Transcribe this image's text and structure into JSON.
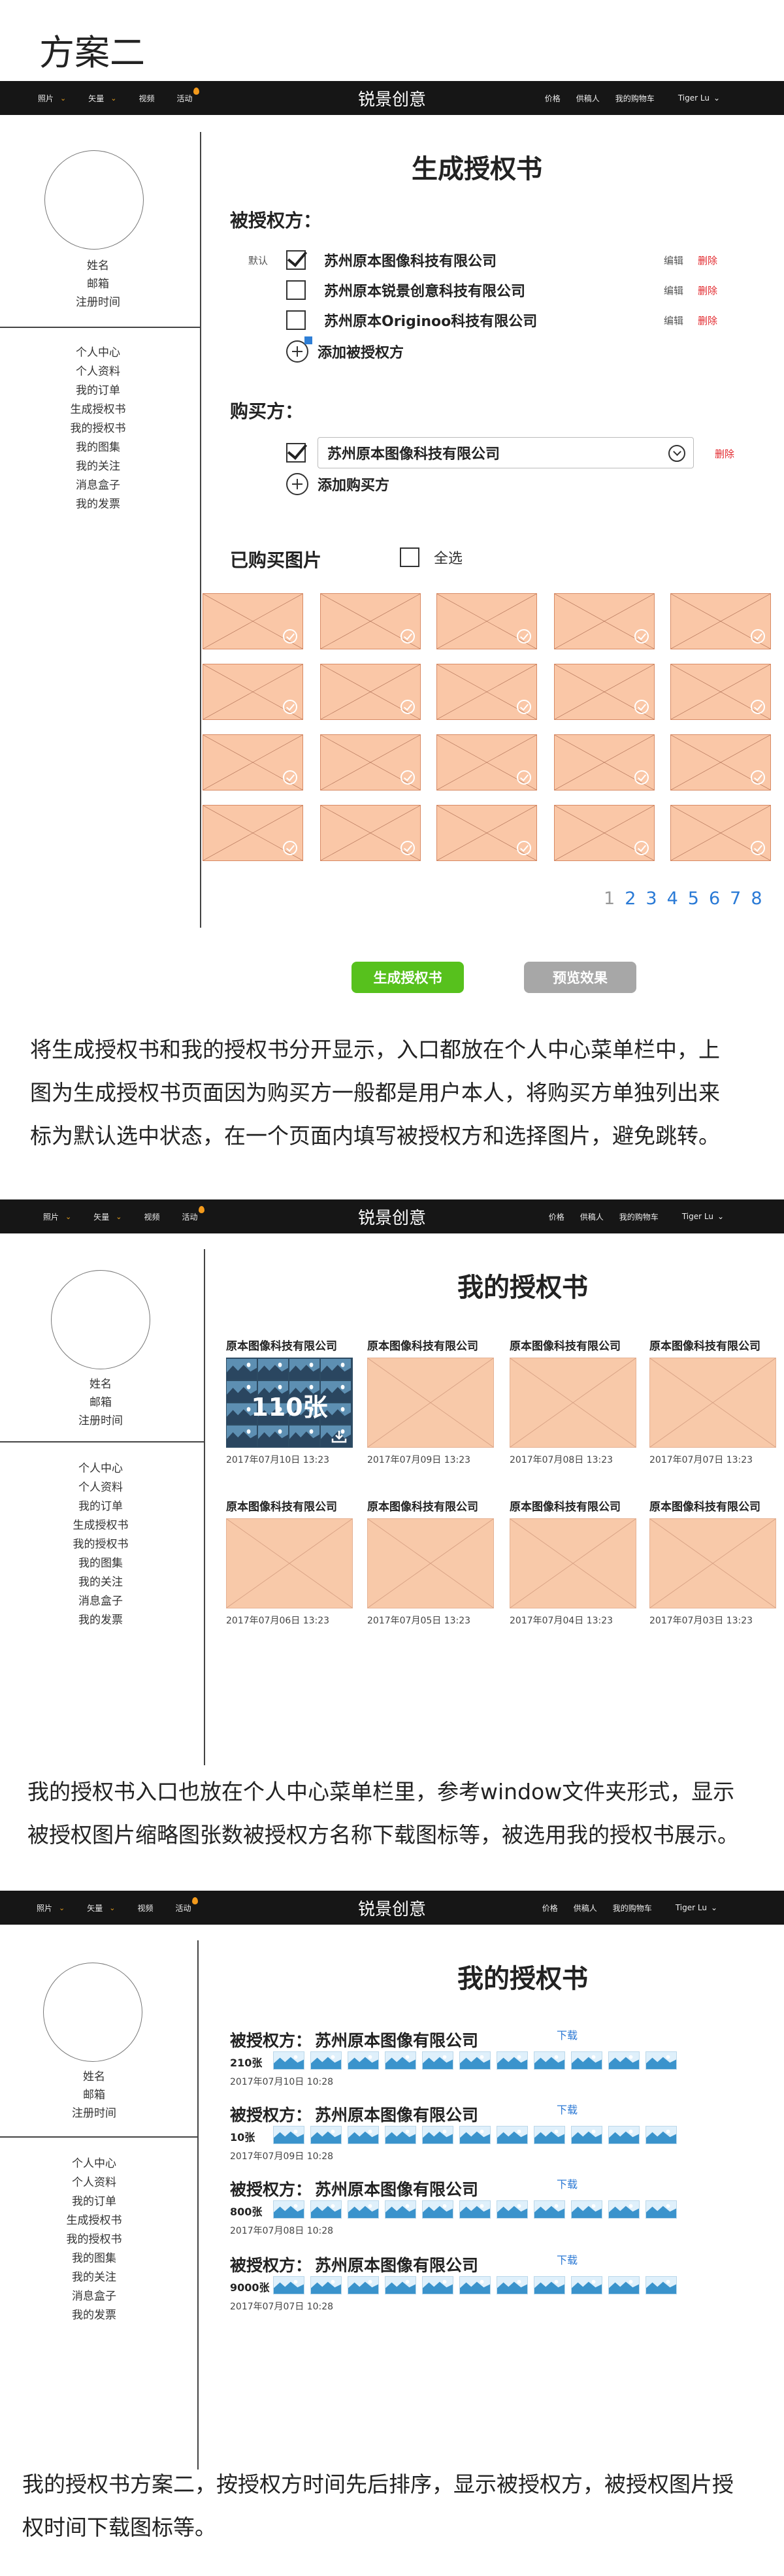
{
  "doc_title": "方案二",
  "nav": {
    "items": [
      {
        "label": "照片",
        "caret": true
      },
      {
        "label": "矢量",
        "caret": true
      },
      {
        "label": "视频",
        "caret": false
      },
      {
        "label": "活动",
        "caret": false
      }
    ],
    "brand": "锐景创意",
    "right": [
      "价格",
      "供稿人",
      "我的购物车"
    ],
    "user": "Tiger Lu"
  },
  "profile": {
    "name": "姓名",
    "email": "邮箱",
    "reg_time": "注册时间"
  },
  "menu": [
    "个人中心",
    "个人资料",
    "我的订单",
    "生成授权书",
    "我的授权书",
    "我的图集",
    "我的关注",
    "消息盒子",
    "我的发票"
  ],
  "s1": {
    "title": "生成授权书",
    "licensee_label": "被授权方：",
    "default_tag": "默认",
    "edit": "编辑",
    "delete": "删除",
    "licensees": [
      {
        "name": "苏州原本图像科技有限公司",
        "checked": true
      },
      {
        "name": "苏州原本锐景创意科技有限公司",
        "checked": false
      },
      {
        "name": "苏州原本Originoo科技有限公司",
        "checked": false
      }
    ],
    "add_licensee": "添加被授权方",
    "buyer_label": "购买方：",
    "buyer": "苏州原本图像科技有限公司",
    "add_buyer": "添加购买方",
    "purchased_label": "已购买图片",
    "select_all": "全选",
    "pages": [
      "1",
      "2",
      "3",
      "4",
      "5",
      "6",
      "7",
      "8"
    ],
    "btn_generate": "生成授权书",
    "btn_preview": "预览效果",
    "desc": [
      "将生成授权书和我的授权书分开显示，入口都放在个人中心菜单栏中，上",
      "图为生成授权书页面因为购买方一般都是用户本人，将购买方单独列出来",
      "标为默认选中状态，在一个页面内填写被授权方和选择图片，避免跳转。"
    ]
  },
  "s2": {
    "title": "我的授权书",
    "cards": [
      {
        "owner": "原本图像科技有限公司",
        "date": "2017年07月10日 13:23",
        "count": "110张"
      },
      {
        "owner": "原本图像科技有限公司",
        "date": "2017年07月09日 13:23"
      },
      {
        "owner": "原本图像科技有限公司",
        "date": "2017年07月08日 13:23"
      },
      {
        "owner": "原本图像科技有限公司",
        "date": "2017年07月07日 13:23"
      },
      {
        "owner": "原本图像科技有限公司",
        "date": "2017年07月06日 13:23"
      },
      {
        "owner": "原本图像科技有限公司",
        "date": "2017年07月05日 13:23"
      },
      {
        "owner": "原本图像科技有限公司",
        "date": "2017年07月04日 13:23"
      },
      {
        "owner": "原本图像科技有限公司",
        "date": "2017年07月03日 13:23"
      }
    ],
    "desc": [
      "我的授权书入口也放在个人中心菜单栏里，参考window文件夹形式，显示",
      "被授权图片缩略图张数被授权方名称下载图标等，被选用我的授权书展示。"
    ]
  },
  "s3": {
    "title": "我的授权书",
    "label": "被授权方：",
    "download": "下载",
    "entries": [
      {
        "company": "苏州原本图像有限公司",
        "count": "210张",
        "date": "2017年07月10日 10:28"
      },
      {
        "company": "苏州原本图像有限公司",
        "count": "10张",
        "date": "2017年07月09日 10:28"
      },
      {
        "company": "苏州原本图像有限公司",
        "count": "800张",
        "date": "2017年07月08日 10:28"
      },
      {
        "company": "苏州原本图像有限公司",
        "count": "9000张",
        "date": "2017年07月07日 10:28"
      }
    ],
    "desc": [
      "我的授权书方案二，按授权方时间先后排序，显示被授权方，被授权图片授",
      "权时间下载图标等。"
    ]
  },
  "colors": {
    "accent_green": "#57c11d",
    "link_blue": "#2a7ad6",
    "delete_red": "#e2262b",
    "thumb_peach": "#fac7a7"
  }
}
